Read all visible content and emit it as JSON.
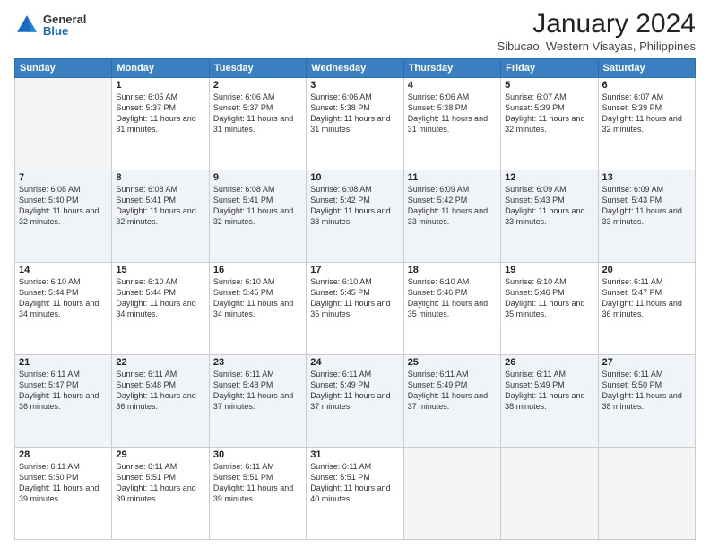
{
  "header": {
    "logo_general": "General",
    "logo_blue": "Blue",
    "month_title": "January 2024",
    "location": "Sibucao, Western Visayas, Philippines"
  },
  "weekdays": [
    "Sunday",
    "Monday",
    "Tuesday",
    "Wednesday",
    "Thursday",
    "Friday",
    "Saturday"
  ],
  "weeks": [
    [
      {
        "day": "",
        "sunrise": "",
        "sunset": "",
        "daylight": "",
        "empty": true
      },
      {
        "day": "1",
        "sunrise": "Sunrise: 6:05 AM",
        "sunset": "Sunset: 5:37 PM",
        "daylight": "Daylight: 11 hours and 31 minutes.",
        "empty": false
      },
      {
        "day": "2",
        "sunrise": "Sunrise: 6:06 AM",
        "sunset": "Sunset: 5:37 PM",
        "daylight": "Daylight: 11 hours and 31 minutes.",
        "empty": false
      },
      {
        "day": "3",
        "sunrise": "Sunrise: 6:06 AM",
        "sunset": "Sunset: 5:38 PM",
        "daylight": "Daylight: 11 hours and 31 minutes.",
        "empty": false
      },
      {
        "day": "4",
        "sunrise": "Sunrise: 6:06 AM",
        "sunset": "Sunset: 5:38 PM",
        "daylight": "Daylight: 11 hours and 31 minutes.",
        "empty": false
      },
      {
        "day": "5",
        "sunrise": "Sunrise: 6:07 AM",
        "sunset": "Sunset: 5:39 PM",
        "daylight": "Daylight: 11 hours and 32 minutes.",
        "empty": false
      },
      {
        "day": "6",
        "sunrise": "Sunrise: 6:07 AM",
        "sunset": "Sunset: 5:39 PM",
        "daylight": "Daylight: 11 hours and 32 minutes.",
        "empty": false
      }
    ],
    [
      {
        "day": "7",
        "sunrise": "Sunrise: 6:08 AM",
        "sunset": "Sunset: 5:40 PM",
        "daylight": "Daylight: 11 hours and 32 minutes.",
        "empty": false
      },
      {
        "day": "8",
        "sunrise": "Sunrise: 6:08 AM",
        "sunset": "Sunset: 5:41 PM",
        "daylight": "Daylight: 11 hours and 32 minutes.",
        "empty": false
      },
      {
        "day": "9",
        "sunrise": "Sunrise: 6:08 AM",
        "sunset": "Sunset: 5:41 PM",
        "daylight": "Daylight: 11 hours and 32 minutes.",
        "empty": false
      },
      {
        "day": "10",
        "sunrise": "Sunrise: 6:08 AM",
        "sunset": "Sunset: 5:42 PM",
        "daylight": "Daylight: 11 hours and 33 minutes.",
        "empty": false
      },
      {
        "day": "11",
        "sunrise": "Sunrise: 6:09 AM",
        "sunset": "Sunset: 5:42 PM",
        "daylight": "Daylight: 11 hours and 33 minutes.",
        "empty": false
      },
      {
        "day": "12",
        "sunrise": "Sunrise: 6:09 AM",
        "sunset": "Sunset: 5:43 PM",
        "daylight": "Daylight: 11 hours and 33 minutes.",
        "empty": false
      },
      {
        "day": "13",
        "sunrise": "Sunrise: 6:09 AM",
        "sunset": "Sunset: 5:43 PM",
        "daylight": "Daylight: 11 hours and 33 minutes.",
        "empty": false
      }
    ],
    [
      {
        "day": "14",
        "sunrise": "Sunrise: 6:10 AM",
        "sunset": "Sunset: 5:44 PM",
        "daylight": "Daylight: 11 hours and 34 minutes.",
        "empty": false
      },
      {
        "day": "15",
        "sunrise": "Sunrise: 6:10 AM",
        "sunset": "Sunset: 5:44 PM",
        "daylight": "Daylight: 11 hours and 34 minutes.",
        "empty": false
      },
      {
        "day": "16",
        "sunrise": "Sunrise: 6:10 AM",
        "sunset": "Sunset: 5:45 PM",
        "daylight": "Daylight: 11 hours and 34 minutes.",
        "empty": false
      },
      {
        "day": "17",
        "sunrise": "Sunrise: 6:10 AM",
        "sunset": "Sunset: 5:45 PM",
        "daylight": "Daylight: 11 hours and 35 minutes.",
        "empty": false
      },
      {
        "day": "18",
        "sunrise": "Sunrise: 6:10 AM",
        "sunset": "Sunset: 5:46 PM",
        "daylight": "Daylight: 11 hours and 35 minutes.",
        "empty": false
      },
      {
        "day": "19",
        "sunrise": "Sunrise: 6:10 AM",
        "sunset": "Sunset: 5:46 PM",
        "daylight": "Daylight: 11 hours and 35 minutes.",
        "empty": false
      },
      {
        "day": "20",
        "sunrise": "Sunrise: 6:11 AM",
        "sunset": "Sunset: 5:47 PM",
        "daylight": "Daylight: 11 hours and 36 minutes.",
        "empty": false
      }
    ],
    [
      {
        "day": "21",
        "sunrise": "Sunrise: 6:11 AM",
        "sunset": "Sunset: 5:47 PM",
        "daylight": "Daylight: 11 hours and 36 minutes.",
        "empty": false
      },
      {
        "day": "22",
        "sunrise": "Sunrise: 6:11 AM",
        "sunset": "Sunset: 5:48 PM",
        "daylight": "Daylight: 11 hours and 36 minutes.",
        "empty": false
      },
      {
        "day": "23",
        "sunrise": "Sunrise: 6:11 AM",
        "sunset": "Sunset: 5:48 PM",
        "daylight": "Daylight: 11 hours and 37 minutes.",
        "empty": false
      },
      {
        "day": "24",
        "sunrise": "Sunrise: 6:11 AM",
        "sunset": "Sunset: 5:49 PM",
        "daylight": "Daylight: 11 hours and 37 minutes.",
        "empty": false
      },
      {
        "day": "25",
        "sunrise": "Sunrise: 6:11 AM",
        "sunset": "Sunset: 5:49 PM",
        "daylight": "Daylight: 11 hours and 37 minutes.",
        "empty": false
      },
      {
        "day": "26",
        "sunrise": "Sunrise: 6:11 AM",
        "sunset": "Sunset: 5:49 PM",
        "daylight": "Daylight: 11 hours and 38 minutes.",
        "empty": false
      },
      {
        "day": "27",
        "sunrise": "Sunrise: 6:11 AM",
        "sunset": "Sunset: 5:50 PM",
        "daylight": "Daylight: 11 hours and 38 minutes.",
        "empty": false
      }
    ],
    [
      {
        "day": "28",
        "sunrise": "Sunrise: 6:11 AM",
        "sunset": "Sunset: 5:50 PM",
        "daylight": "Daylight: 11 hours and 39 minutes.",
        "empty": false
      },
      {
        "day": "29",
        "sunrise": "Sunrise: 6:11 AM",
        "sunset": "Sunset: 5:51 PM",
        "daylight": "Daylight: 11 hours and 39 minutes.",
        "empty": false
      },
      {
        "day": "30",
        "sunrise": "Sunrise: 6:11 AM",
        "sunset": "Sunset: 5:51 PM",
        "daylight": "Daylight: 11 hours and 39 minutes.",
        "empty": false
      },
      {
        "day": "31",
        "sunrise": "Sunrise: 6:11 AM",
        "sunset": "Sunset: 5:51 PM",
        "daylight": "Daylight: 11 hours and 40 minutes.",
        "empty": false
      },
      {
        "day": "",
        "sunrise": "",
        "sunset": "",
        "daylight": "",
        "empty": true
      },
      {
        "day": "",
        "sunrise": "",
        "sunset": "",
        "daylight": "",
        "empty": true
      },
      {
        "day": "",
        "sunrise": "",
        "sunset": "",
        "daylight": "",
        "empty": true
      }
    ]
  ]
}
